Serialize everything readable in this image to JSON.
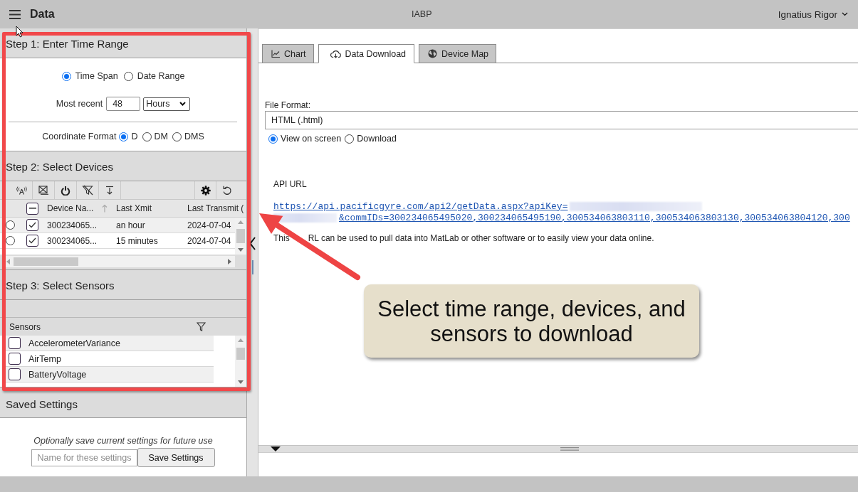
{
  "header": {
    "title": "Data",
    "app_name": "IABP",
    "user": "Ignatius Rigor"
  },
  "sidebar": {
    "time_range": {
      "title": "Step 1: Enter Time Range",
      "modes": [
        {
          "label": "Time Span",
          "selected": true
        },
        {
          "label": "Date Range",
          "selected": false
        }
      ],
      "most_recent": {
        "label": "Most recent",
        "value": "48",
        "unit": "Hours"
      },
      "coordinate_format": {
        "label": "Coordinate Format",
        "options": [
          {
            "label": "D",
            "selected": true
          },
          {
            "label": "DM",
            "selected": false
          },
          {
            "label": "DMS",
            "selected": false
          }
        ]
      }
    },
    "devices": {
      "title": "Step 2: Select Devices",
      "select_all_partial": true,
      "columns": [
        {
          "label": "Device Na...",
          "sort_arrow": true
        },
        {
          "label": "Last Xmit",
          "sort_arrow": false
        },
        {
          "label": "Last Transmit (",
          "sort_arrow": false
        }
      ],
      "rows": [
        {
          "selected": false,
          "checked": true,
          "cells": [
            "300234065...",
            "an hour",
            "2024-07-04"
          ]
        },
        {
          "selected": false,
          "checked": true,
          "cells": [
            "300234065...",
            "15 minutes",
            "2024-07-04"
          ]
        }
      ]
    },
    "sensors": {
      "title": "Step 3: Select Sensors",
      "column": "Sensors",
      "items": [
        {
          "label": "AccelerometerVariance",
          "checked": false
        },
        {
          "label": "AirTemp",
          "checked": false
        },
        {
          "label": "BatteryVoltage",
          "checked": false
        }
      ]
    },
    "saved_settings": {
      "title": "Saved Settings",
      "hint": "Optionally save current settings for future use",
      "name_field": {
        "placeholder": "Name for these settings"
      },
      "save_button": "Save Settings"
    }
  },
  "main": {
    "tabs": [
      {
        "label": "Chart",
        "kind": "chart",
        "selected": false
      },
      {
        "label": "Data Download",
        "kind": "download",
        "selected": true
      },
      {
        "label": "Device Map",
        "kind": "map",
        "selected": false
      }
    ],
    "file_format": {
      "label": "File Format:",
      "value": "HTML (.html)"
    },
    "output_modes": [
      {
        "label": "View on screen",
        "selected": true
      },
      {
        "label": "Download",
        "selected": false
      }
    ],
    "api": {
      "label": "API URL",
      "link_lines": [
        "https://api.pacificgyre.com/api2/getData.aspx?apiKey=",
        "&commIDs=300234065495020,300234065495190,300534063803110,300534063803130,300534063804120,300"
      ],
      "note_parts": [
        "This",
        "RL can be used to pull data into MatLab or other software or to easily view your data online."
      ]
    }
  },
  "annotation": {
    "callout": "Select time range, devices, and sensors to download"
  }
}
